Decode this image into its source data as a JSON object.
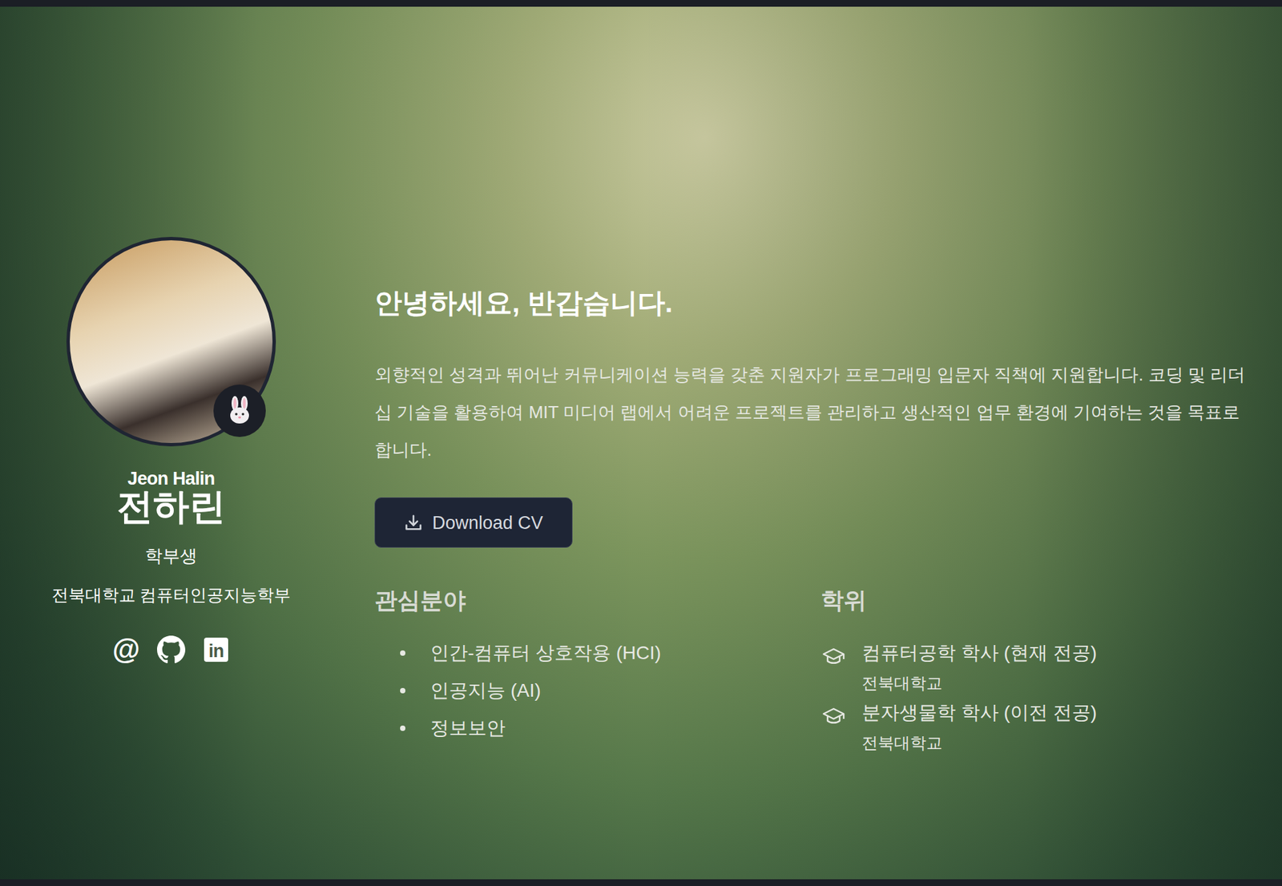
{
  "profile": {
    "name_en": "Jeon Halin",
    "name_ko": "전하린",
    "role": "학부생",
    "affiliation": "전북대학교 컴퓨터인공지능학부"
  },
  "links": [
    {
      "kind": "email",
      "glyph": "@"
    },
    {
      "kind": "github"
    },
    {
      "kind": "linkedin",
      "glyph": "in"
    }
  ],
  "intro": {
    "title": "안녕하세요, 반갑습니다.",
    "body": "외향적인 성격과 뛰어난 커뮤니케이션 능력을 갖춘 지원자가 프로그래밍 입문자 직책에 지원합니다. 코딩 및 리더십 기술을 활용하여 MIT 미디어 랩에서 어려운 프로젝트를 관리하고 생산적인 업무 환경에 기여하는 것을 목표로 합니다.",
    "cv_button": "Download CV"
  },
  "interests": {
    "title": "관심분야",
    "items": [
      "인간-컴퓨터 상호작용 (HCI)",
      "인공지능 (AI)",
      "정보보안"
    ]
  },
  "degrees": {
    "title": "학위",
    "items": [
      {
        "degree": "컴퓨터공학 학사 (현재 전공)",
        "school": "전북대학교"
      },
      {
        "degree": "분자생물학 학사 (이전 전공)",
        "school": "전북대학교"
      }
    ]
  }
}
